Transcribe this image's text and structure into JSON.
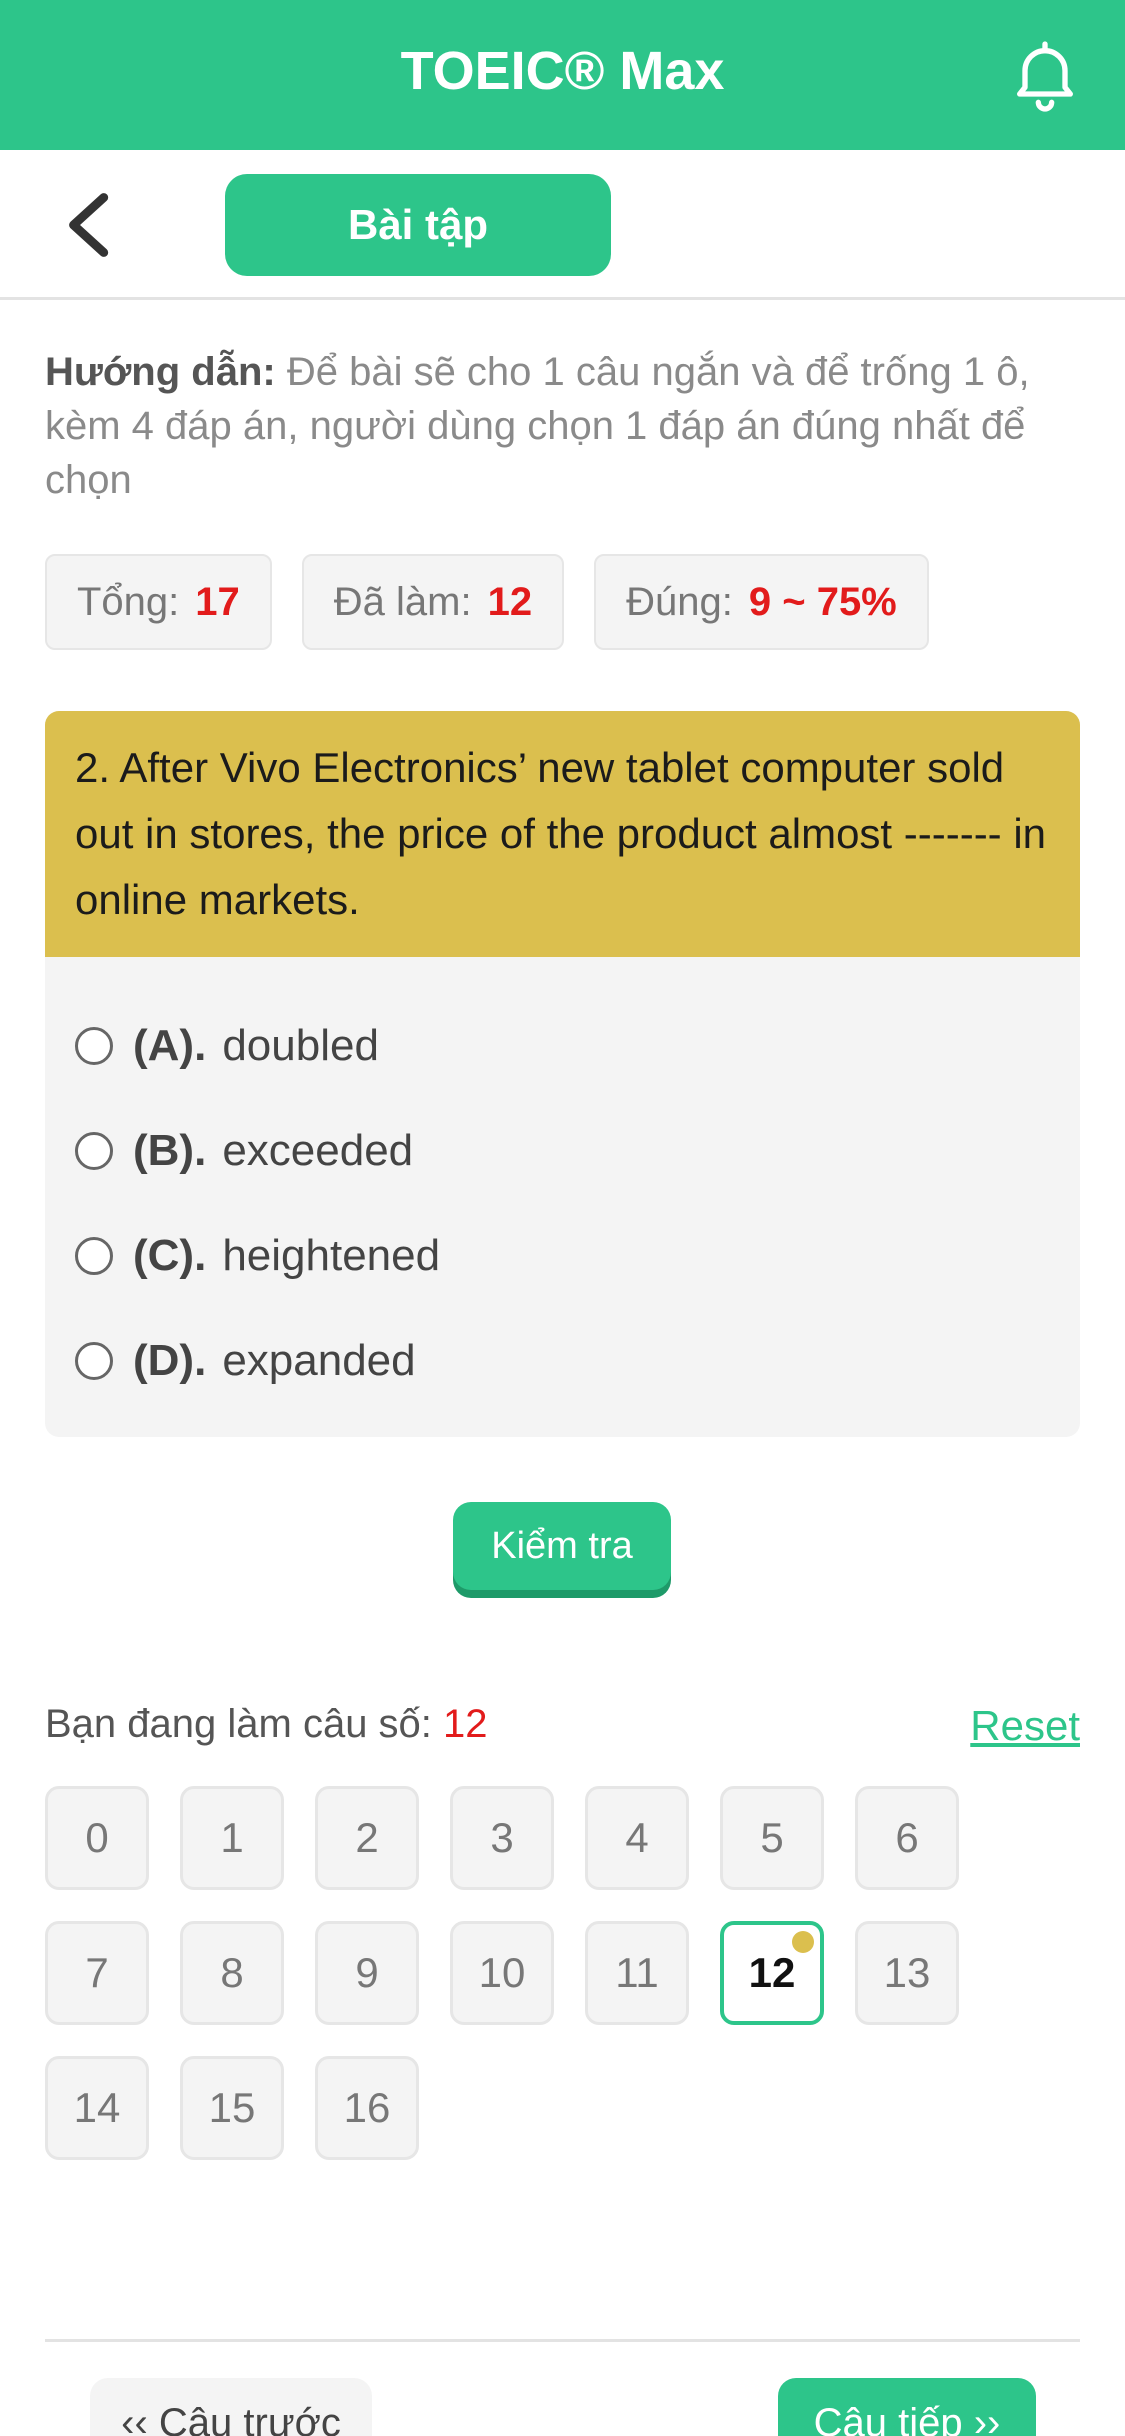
{
  "app": {
    "title": "TOEIC® Max",
    "bell_icon": "bell-icon"
  },
  "subheader": {
    "back_icon": "chevron-left-icon",
    "tab_label": "Bài tập"
  },
  "instruction": {
    "label": "Hướng dẫn:",
    "text": "Để bài sẽ cho 1 câu ngắn và để trống 1 ô, kèm 4 đáp án, người dùng chọn 1 đáp án đúng nhất để chọn"
  },
  "stats": {
    "total_label": "Tổng:",
    "total_value": "17",
    "done_label": "Đã làm:",
    "done_value": "12",
    "correct_label": "Đúng:",
    "correct_value": "9 ~ 75%"
  },
  "question": {
    "text": "2. After Vivo Electronics’ new tablet computer sold out in stores, the price of the product almost ------- in online markets.",
    "options": [
      {
        "letter": "(A).",
        "text": "doubled"
      },
      {
        "letter": "(B).",
        "text": "exceeded"
      },
      {
        "letter": "(C).",
        "text": "heightened"
      },
      {
        "letter": "(D).",
        "text": "expanded"
      }
    ]
  },
  "check_button": "Kiểm tra",
  "progress": {
    "label": "Bạn đang làm câu số:",
    "current": "12",
    "reset_label": "Reset"
  },
  "question_numbers": [
    "0",
    "1",
    "2",
    "3",
    "4",
    "5",
    "6",
    "7",
    "8",
    "9",
    "10",
    "11",
    "12",
    "13",
    "14",
    "15",
    "16"
  ],
  "nav": {
    "prev_label": "‹‹ Câu trước",
    "next_label": "Câu tiếp ››"
  },
  "colors": {
    "brand": "#2dc58a",
    "question_header": "#dbbf4e",
    "highlight_value": "#e21b1b"
  }
}
